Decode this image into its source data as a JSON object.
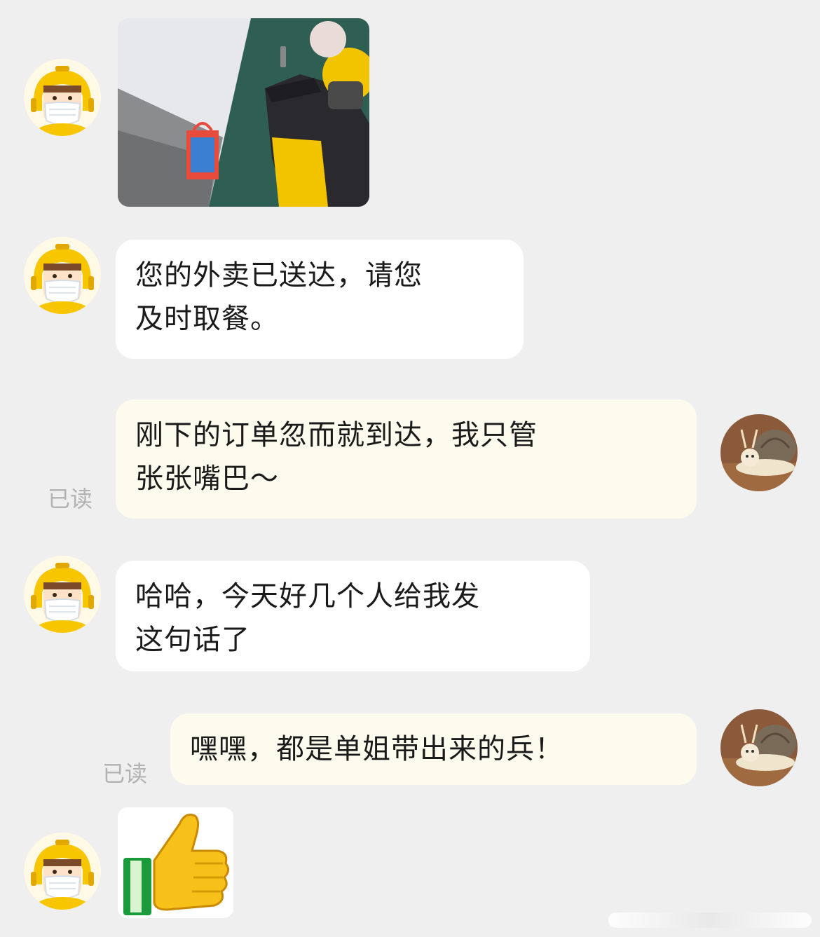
{
  "messages": [
    {
      "id": "m1",
      "sender": "courier",
      "type": "image",
      "image_name": "courier-delivery-photo"
    },
    {
      "id": "m2",
      "sender": "courier",
      "type": "text",
      "text": "您的外卖已送达，请您\n及时取餐。"
    },
    {
      "id": "m3",
      "sender": "me",
      "type": "text",
      "text": "刚下的订单忽而就到达，我只管\n张张嘴巴～",
      "status": "已读"
    },
    {
      "id": "m4",
      "sender": "courier",
      "type": "text",
      "text": "哈哈，今天好几个人给我发\n这句话了"
    },
    {
      "id": "m5",
      "sender": "me",
      "type": "text",
      "text": "嘿嘿，都是单姐带出来的兵！",
      "status": "已读"
    },
    {
      "id": "m6",
      "sender": "courier",
      "type": "sticker",
      "sticker_name": "thumbs-up-sticker"
    }
  ],
  "avatars": {
    "courier": "courier-helmet-avatar",
    "me": "cat-snail-avatar"
  },
  "colors": {
    "background": "#efefef",
    "incoming_bubble": "#ffffff",
    "outgoing_bubble": "#fdfbee",
    "read_status": "#b2b2b2",
    "helmet_yellow": "#f7c600"
  }
}
